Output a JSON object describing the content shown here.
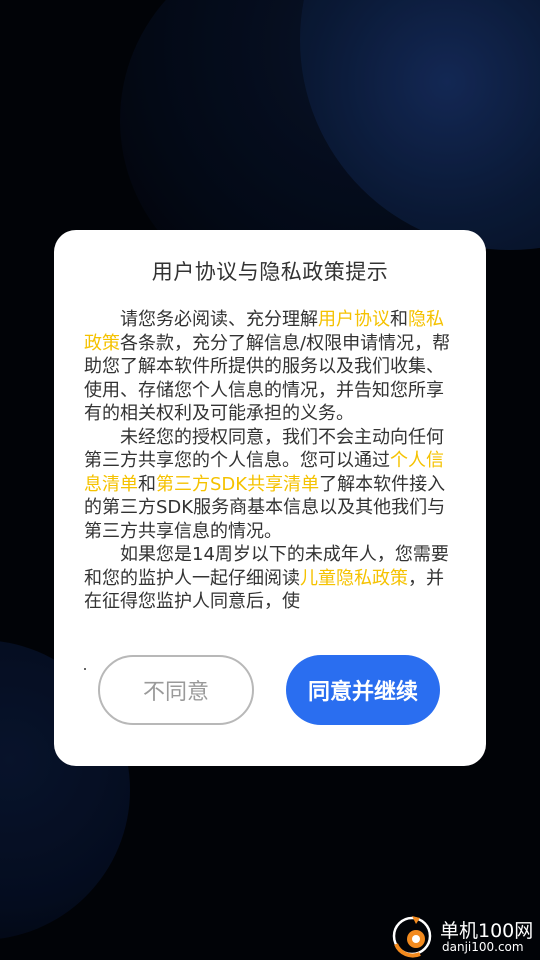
{
  "dialog": {
    "title": "用户协议与隐私政策提示",
    "paragraphs": [
      {
        "segments": [
          {
            "text": "请您务必阅读、充分理解",
            "link": false
          },
          {
            "text": "用户协议",
            "link": true
          },
          {
            "text": "和",
            "link": false
          },
          {
            "text": "隐私政策",
            "link": true
          },
          {
            "text": "各条款，充分了解信息/权限申请情况，帮助您了解本软件所提供的服务以及我们收集、使用、存储您个人信息的情况，并告知您所享有的相关权利及可能承担的义务。",
            "link": false
          }
        ]
      },
      {
        "segments": [
          {
            "text": "未经您的授权同意，我们不会主动向任何第三方共享您的个人信息。您可以通过",
            "link": false
          },
          {
            "text": "个人信息清单",
            "link": true
          },
          {
            "text": "和",
            "link": false
          },
          {
            "text": "第三方SDK共享清单",
            "link": true
          },
          {
            "text": "了解本软件接入的第三方SDK服务商基本信息以及其他我们与第三方共享信息的情况。",
            "link": false
          }
        ]
      },
      {
        "segments": [
          {
            "text": "如果您是14周岁以下的未成年人，您需要和您的监护人一起仔细阅读",
            "link": false
          },
          {
            "text": "儿童隐私政策",
            "link": true
          },
          {
            "text": "，并在征得您监护人同意后，使",
            "link": false
          }
        ]
      }
    ],
    "disagree_label": "不同意",
    "agree_label": "同意并继续"
  },
  "watermark": {
    "brand": "单机100网",
    "domain": "danji100.com",
    "icon": "danji100-logo-icon"
  },
  "colors": {
    "link": "#f5c200",
    "agree_button": "#2a6ef0",
    "text": "#333333"
  }
}
